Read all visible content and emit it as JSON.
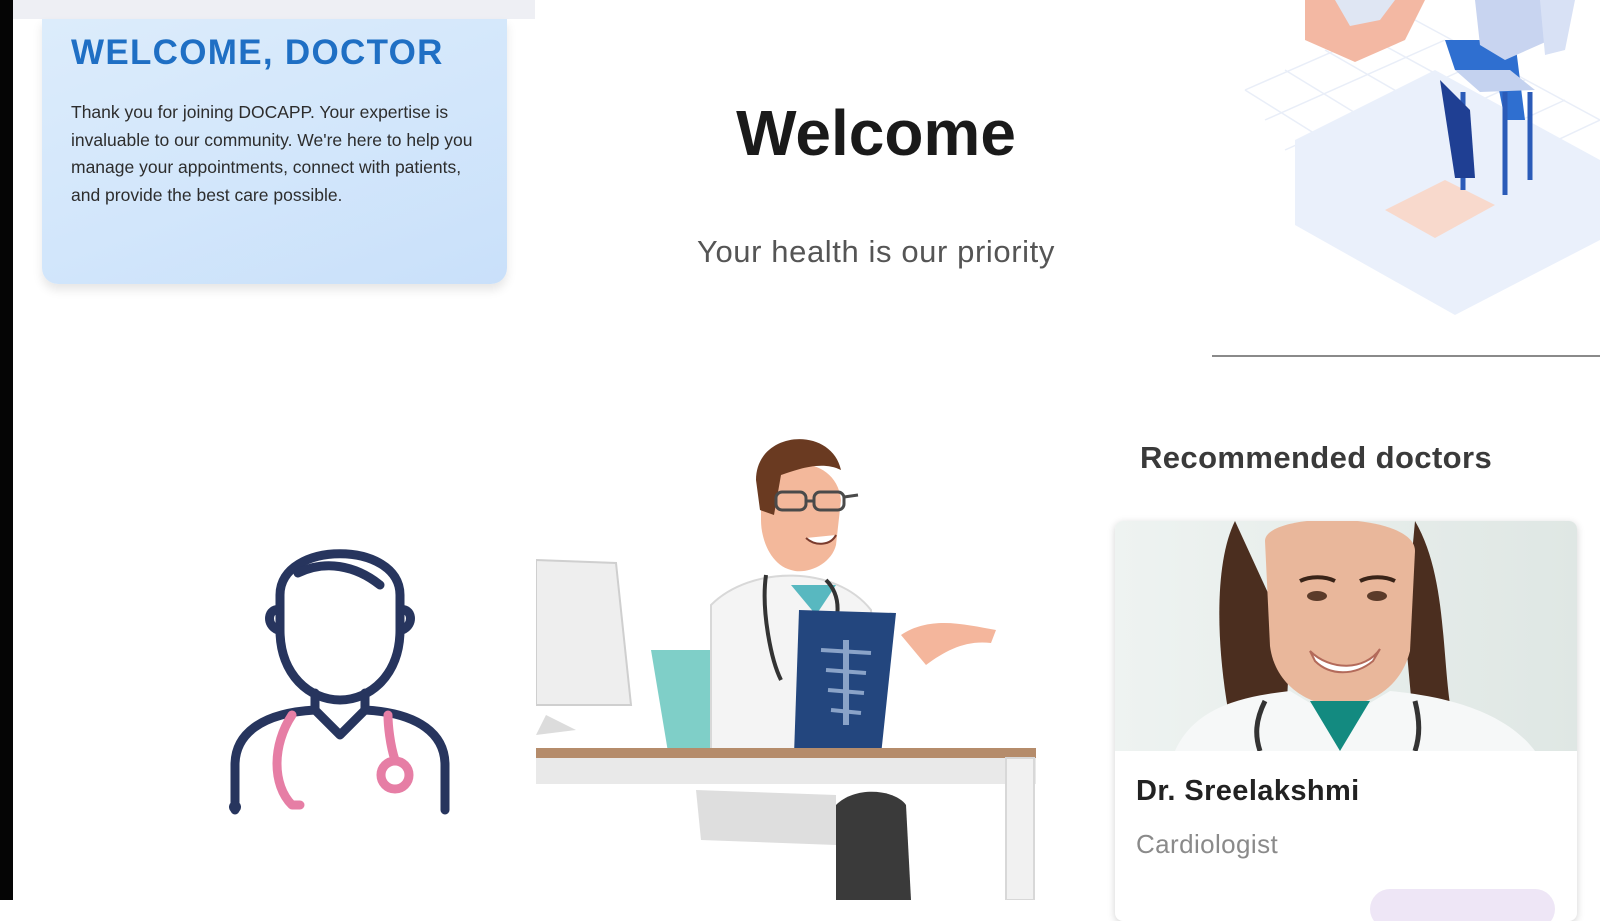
{
  "welcome_card": {
    "heading": "WELCOME, DOCTOR",
    "message": "Thank you for joining DOCAPP. Your expertise is invaluable to our community. We're here to help you manage your appointments, connect with patients, and provide the best care possible."
  },
  "hero": {
    "title": "Welcome",
    "subtitle": "Your health is our priority"
  },
  "recommended": {
    "title": "Recommended doctors",
    "doctors": [
      {
        "name": "Dr. Sreelakshmi",
        "specialty": "Cardiologist"
      }
    ]
  },
  "colors": {
    "accent_blue": "#1f6fc4",
    "card_gradient": "#d2e6fb",
    "icon_navy": "#27355e",
    "icon_pink": "#e67ea5"
  },
  "icons": [
    "doctor-outline-icon",
    "doctor-desk-illustration",
    "isometric-clinic-illustration"
  ]
}
